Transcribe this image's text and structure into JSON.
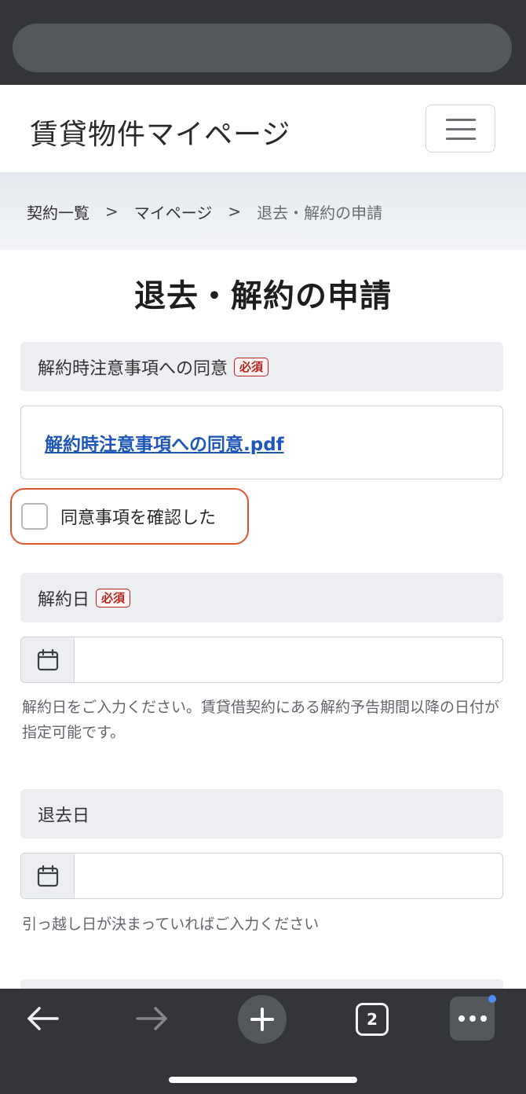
{
  "site": {
    "title": "賃貸物件マイページ"
  },
  "breadcrumb": {
    "items": [
      "契約一覧",
      "マイページ"
    ],
    "separator": ">",
    "current": "退去・解約の申請"
  },
  "page": {
    "title": "退去・解約の申請"
  },
  "sections": {
    "agreement": {
      "label": "解約時注意事項への同意",
      "required_badge": "必須",
      "pdf_link": "解約時注意事項への同意.pdf",
      "checkbox_label": "同意事項を確認した"
    },
    "cancel_date": {
      "label": "解約日",
      "required_badge": "必須",
      "help": "解約日をご入力ください。賃貸借契約にある解約予告期間以降の日付が指定可能です。"
    },
    "move_out_date": {
      "label": "退去日",
      "help": "引っ越し日が決まっていればご入力ください"
    }
  },
  "browser": {
    "tab_count": "2",
    "icons": [
      "back-arrow-icon",
      "forward-arrow-icon",
      "new-tab-plus-icon",
      "tab-switcher-icon",
      "more-menu-icon",
      "calendar-icon",
      "hamburger-menu-icon"
    ],
    "colors": {
      "chrome": "#333538",
      "link": "#1f57b8",
      "required": "#b3261e",
      "highlight": "#e1542c"
    }
  }
}
